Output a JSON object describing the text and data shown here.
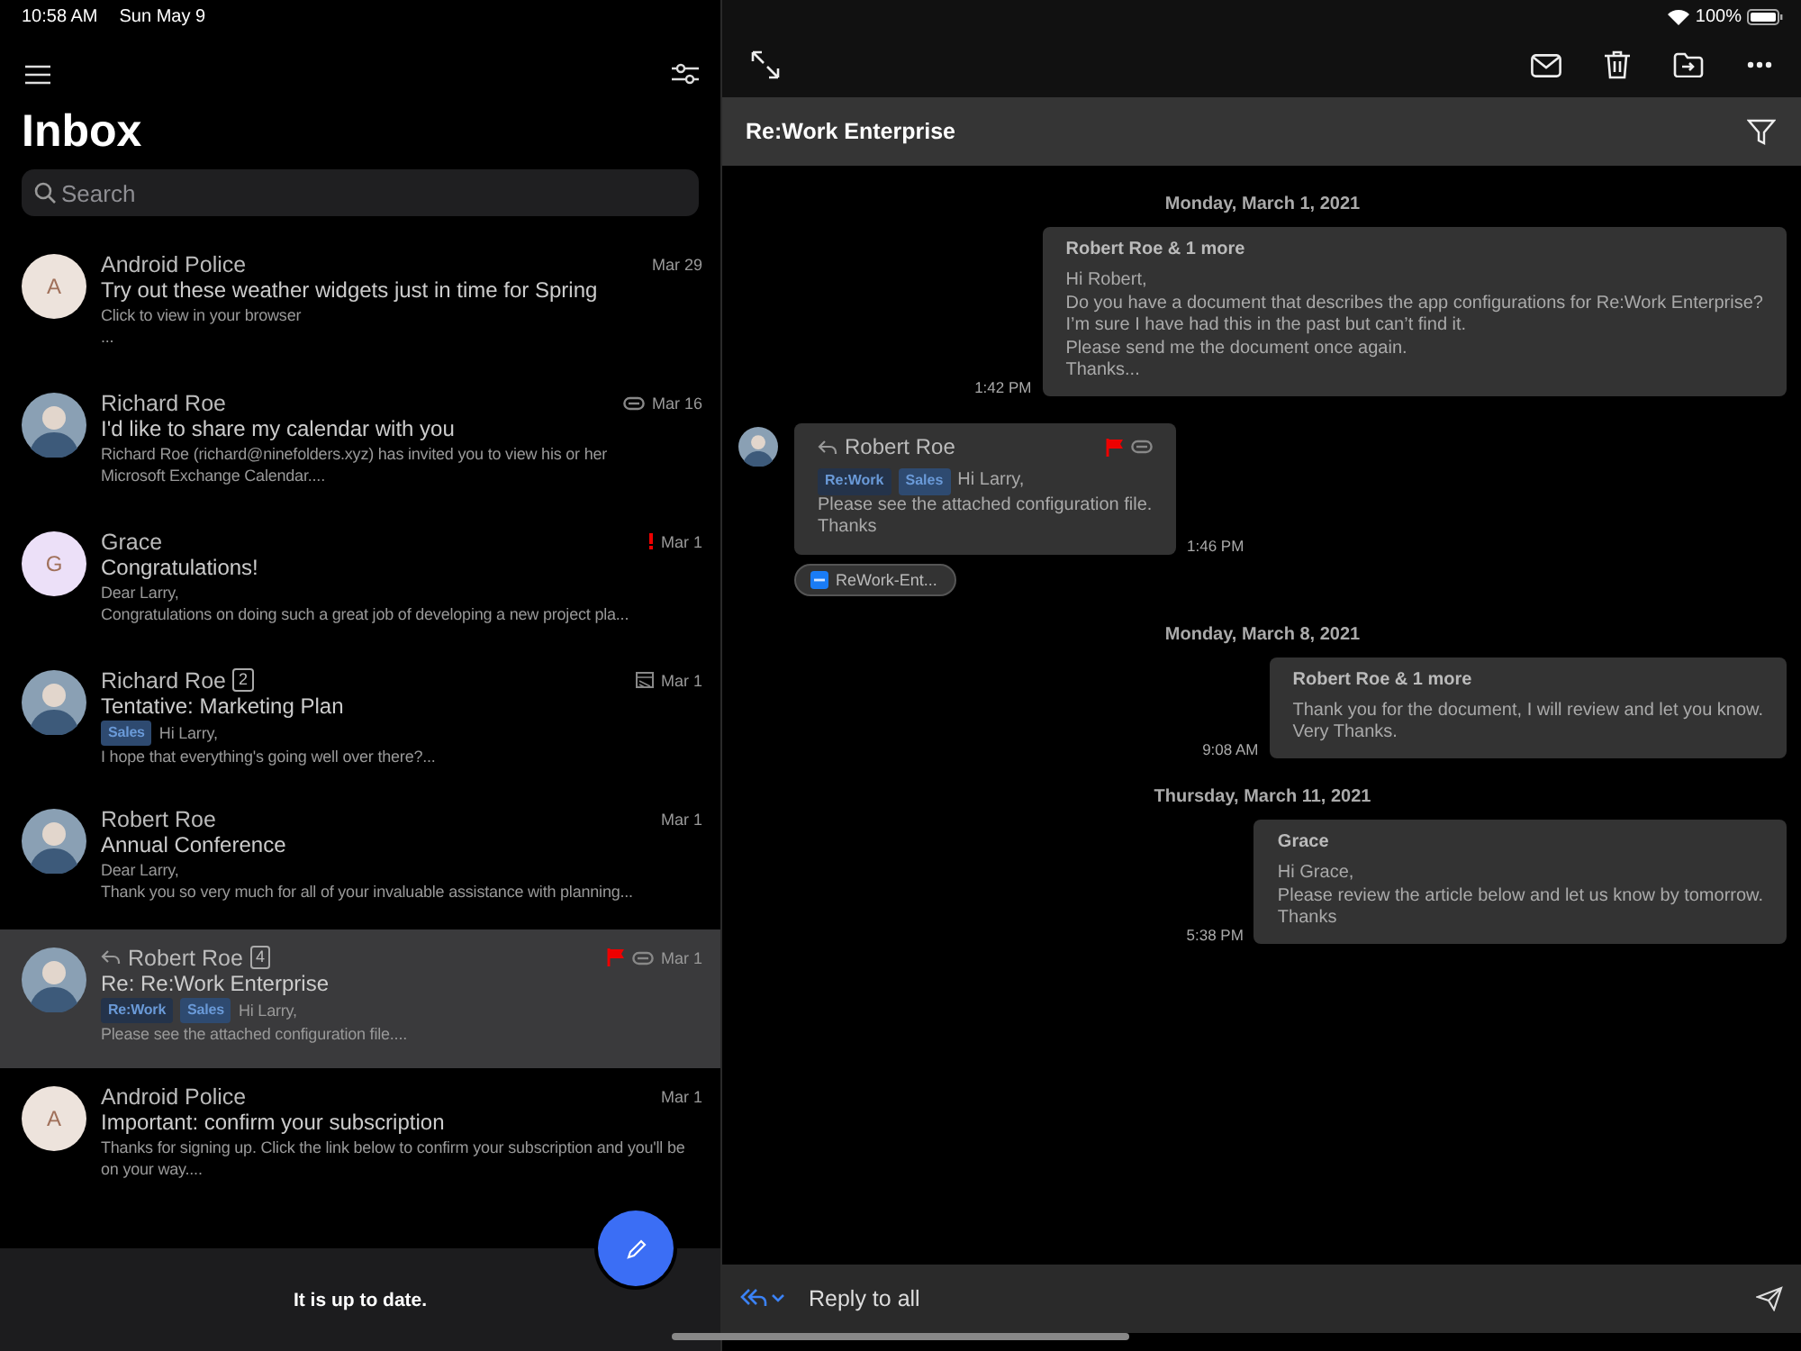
{
  "status_bar": {
    "time": "10:58 AM",
    "date": "Sun May 9",
    "battery": "100%"
  },
  "mailbox": {
    "title": "Inbox",
    "search": {
      "placeholder": "Search"
    }
  },
  "messages": [
    {
      "sender": "Android Police",
      "avatar": {
        "kind": "letter",
        "letter": "A",
        "color": "#ede3dc"
      },
      "date": "Mar 29",
      "subject": "Try out these weather widgets just in time for Spring",
      "preview": [
        "Click to view in your browser",
        "..."
      ],
      "selected": false
    },
    {
      "sender": "Richard Roe",
      "avatar": {
        "kind": "photo"
      },
      "attachment": true,
      "date": "Mar 16",
      "subject": "I'd like to share my calendar with you",
      "preview": [
        "Richard Roe (richard@ninefolders.xyz) has invited you to view his or her",
        "Microsoft Exchange Calendar...."
      ],
      "selected": false
    },
    {
      "sender": "Grace",
      "avatar": {
        "kind": "letter",
        "letter": "G",
        "color": "#ece0f8"
      },
      "important": true,
      "date": "Mar 1",
      "subject": "Congratulations!",
      "preview": [
        "Dear Larry,",
        "Congratulations on doing such a great job of developing a new project pla..."
      ],
      "selected": false
    },
    {
      "sender": "Richard Roe",
      "count": "2",
      "avatar": {
        "kind": "photo"
      },
      "calendar": true,
      "date": "Mar 1",
      "subject": "Tentative: Marketing Plan",
      "tags": [
        {
          "label": "Sales",
          "color": "#2e4a70"
        }
      ],
      "preview": [
        "Hi Larry,",
        "I hope that everything's going well over there?..."
      ],
      "selected": false
    },
    {
      "sender": "Robert Roe",
      "avatar": {
        "kind": "photo"
      },
      "date": "Mar 1",
      "subject": "Annual Conference",
      "preview": [
        "Dear Larry,",
        "Thank you so very much for all of your invaluable assistance with planning..."
      ],
      "selected": false
    },
    {
      "sender": "Robert Roe",
      "count": "4",
      "replied": true,
      "flagged": true,
      "attachment": true,
      "avatar": {
        "kind": "photo"
      },
      "date": "Mar 1",
      "subject": "Re: Re:Work Enterprise",
      "tags": [
        {
          "label": "Re:Work",
          "color": "#24334a"
        },
        {
          "label": "Sales",
          "color": "#2e4a70"
        }
      ],
      "preview": [
        "Hi Larry,",
        "Please see the attached configuration file...."
      ],
      "selected": true
    },
    {
      "sender": "Android Police",
      "avatar": {
        "kind": "letter",
        "letter": "A",
        "color": "#ede3dc"
      },
      "date": "Mar 1",
      "subject": "Important: confirm your subscription",
      "preview": [
        "Thanks for signing up. Click the link below to confirm your subscription and you'll be on your way...."
      ],
      "selected": false
    }
  ],
  "sync_status": "It is up to date.",
  "conversation": {
    "title": "Re:Work Enterprise",
    "items": [
      {
        "kind": "date",
        "text": "Monday, March 1, 2021"
      },
      {
        "kind": "sent",
        "sender": "Robert Roe & 1 more",
        "lines": [
          "Hi Robert,",
          "Do you have a document that describes the app configurations for Re:Work Enterprise?",
          "I’m sure I have had this in the past but can’t find it.",
          "Please send me the document once again.",
          "Thanks..."
        ],
        "time": "1:42 PM"
      },
      {
        "kind": "received",
        "sender": "Robert Roe",
        "replied": true,
        "flagged": true,
        "attachment": true,
        "tags": [
          {
            "label": "Re:Work",
            "color": "#24334a"
          },
          {
            "label": "Sales",
            "color": "#2e4a70"
          }
        ],
        "lines": [
          "Hi Larry,",
          "Please see the attached configuration file.",
          "Thanks"
        ],
        "time": "1:46 PM",
        "file": "ReWork-Ent..."
      },
      {
        "kind": "date",
        "text": "Monday, March 8, 2021"
      },
      {
        "kind": "sent",
        "sender": "Robert Roe & 1 more",
        "lines": [
          "Thank you for the document, I will review and let you know.",
          "Very Thanks."
        ],
        "time": "9:08 AM"
      },
      {
        "kind": "date",
        "text": "Thursday, March 11, 2021"
      },
      {
        "kind": "sent",
        "sender": "Grace",
        "lines": [
          "Hi Grace,",
          "Please review the article below and let us know by tomorrow.",
          "Thanks"
        ],
        "time": "5:38 PM"
      }
    ]
  },
  "reply": {
    "label": "Reply to all"
  }
}
